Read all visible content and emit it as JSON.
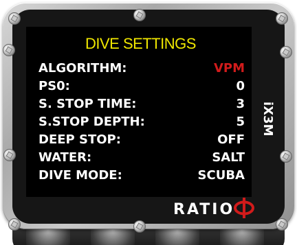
{
  "screen": {
    "title": "DIVE SETTINGS",
    "rows": [
      {
        "label": "ALGORITHM:",
        "value": "VPM"
      },
      {
        "label": "PS0:",
        "value": "0"
      },
      {
        "label": "S. STOP TIME:",
        "value": "3"
      },
      {
        "label": "S.STOP DEPTH:",
        "value": "5"
      },
      {
        "label": "DEEP STOP:",
        "value": "OFF"
      },
      {
        "label": "WATER:",
        "value": "SALT"
      },
      {
        "label": "DIVE MODE:",
        "value": "SCUBA"
      }
    ]
  },
  "device": {
    "model": "iX3M",
    "brand": "RATIO",
    "brand_icon": "phi-icon"
  },
  "colors": {
    "title": "#f0e700",
    "accent_value": "#d11b1b",
    "brand_symbol": "#d11b1b",
    "screen_background": "#000000",
    "bezel": "#b8b8b8"
  }
}
